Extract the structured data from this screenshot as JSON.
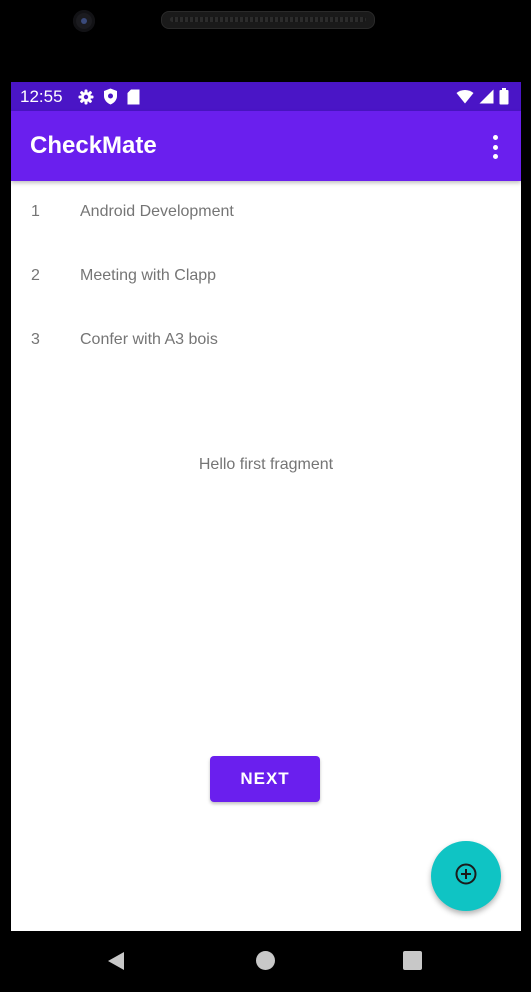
{
  "status_bar": {
    "time": "12:55",
    "left_icons": [
      "gear-icon",
      "shield-icon",
      "sd-card-icon"
    ],
    "right_icons": [
      "wifi-icon",
      "signal-icon",
      "battery-icon"
    ]
  },
  "app_bar": {
    "title": "CheckMate",
    "menu_icon": "more-vert-icon"
  },
  "tasks": [
    {
      "number": "1",
      "text": "Android Development"
    },
    {
      "number": "2",
      "text": "Meeting with Clapp"
    },
    {
      "number": "3",
      "text": "Confer with A3 bois"
    }
  ],
  "fragment_text": "Hello first fragment",
  "next_button": {
    "label": "NEXT"
  },
  "fab": {
    "icon": "add-circle-icon"
  },
  "colors": {
    "status_bar": "#4a15c6",
    "app_bar": "#6a1fee",
    "button": "#6a1fee",
    "fab": "#0fc4c4",
    "text_secondary": "#757575"
  },
  "nav_bar": {
    "icons": [
      "back-icon",
      "home-icon",
      "recents-icon"
    ]
  }
}
